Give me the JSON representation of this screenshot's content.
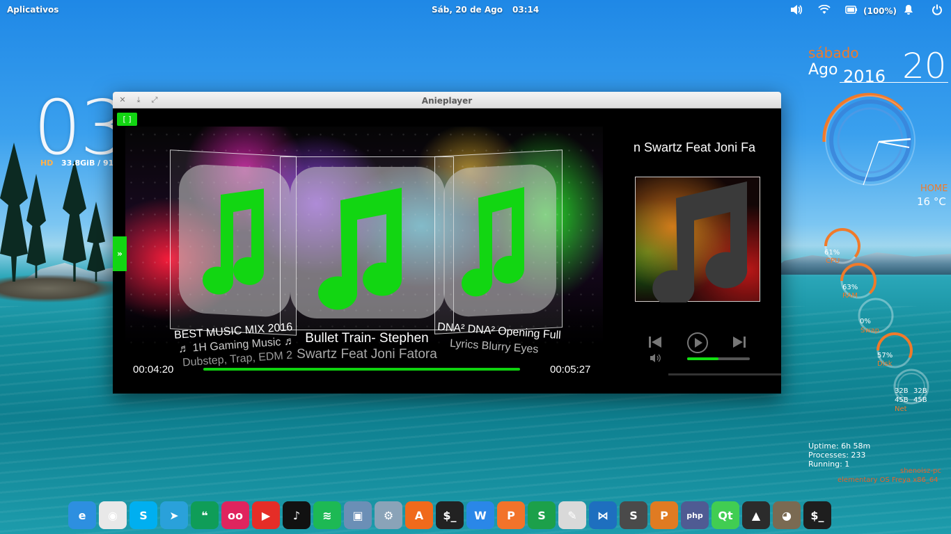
{
  "panel": {
    "apps_label": "Aplicativos",
    "date": "Sáb, 20 de Ago",
    "time": "03:14",
    "battery": "(100%)"
  },
  "conky_left": {
    "big_time": "03",
    "hd_label": "HD",
    "disk_info": "33.8GiB / 91."
  },
  "conky_right": {
    "weekday": "sábado",
    "month": "Ago",
    "year": "2016",
    "day": "20",
    "location": "HOME",
    "temperature": "16 °C",
    "gauges": [
      {
        "value": "61%",
        "label": "CPU",
        "level": 0.61
      },
      {
        "value": "63%",
        "label": "RAM",
        "level": 0.63
      },
      {
        "value": "0%",
        "label": "Swap",
        "level": 0.0
      },
      {
        "value": "57%",
        "label": "Disk",
        "level": 0.57
      }
    ],
    "net": {
      "down_a": "32B",
      "down_b": "32B",
      "up_a": "45B",
      "up_b": "45B",
      "label": "Net"
    },
    "uptime": "Uptime: 6h 58m",
    "processes": "Processes: 233",
    "running": "Running: 1",
    "hostname": "shenoisz-pc",
    "os": "elementary OS Freya  x86_64"
  },
  "player": {
    "window_title": "Anieplayer",
    "fullscreen_label": "[ ]",
    "expand_label": "»",
    "now_playing_title": "n Swartz Feat Joni Fa",
    "covers": [
      {
        "line1": "BEST MUSIC MIX 2016",
        "line2": "♬ 1H Gaming Music ♬",
        "line3": "Dubstep, Trap, EDM 2"
      },
      {
        "line1": "Bullet Train- Stephen",
        "line2": "Swartz Feat Joni Fatora"
      },
      {
        "line1": "DNA² DNA² Opening Full",
        "line2": "Lyrics Blurry Eyes"
      }
    ],
    "elapsed": "00:04:20",
    "total": "00:05:27",
    "progress": 1.0,
    "volume": 0.5
  },
  "dock": [
    {
      "name": "elementary",
      "color": "#2d8fe0",
      "glyph": "e"
    },
    {
      "name": "chrome",
      "color": "#e8e8e8",
      "glyph": "◉"
    },
    {
      "name": "skype",
      "color": "#00aff0",
      "glyph": "S"
    },
    {
      "name": "telegram",
      "color": "#2aa1da",
      "glyph": "➤"
    },
    {
      "name": "hangouts",
      "color": "#0f9d58",
      "glyph": "❝"
    },
    {
      "name": "flickr",
      "color": "#e0245e",
      "glyph": "oo"
    },
    {
      "name": "youtube",
      "color": "#e52d27",
      "glyph": "▶"
    },
    {
      "name": "anieplayer",
      "color": "#111111",
      "glyph": "♪"
    },
    {
      "name": "spotify",
      "color": "#1db954",
      "glyph": "≋"
    },
    {
      "name": "shotwell",
      "color": "#6b8fb6",
      "glyph": "▣"
    },
    {
      "name": "switchboard",
      "color": "#8aa3b8",
      "glyph": "⚙"
    },
    {
      "name": "appcenter",
      "color": "#f06a1b",
      "glyph": "A"
    },
    {
      "name": "terminal",
      "color": "#222222",
      "glyph": "$_"
    },
    {
      "name": "wps-writer",
      "color": "#2a87e8",
      "glyph": "W"
    },
    {
      "name": "wps-presentation",
      "color": "#f2732a",
      "glyph": "P"
    },
    {
      "name": "wps-spreadsheets",
      "color": "#1ca04a",
      "glyph": "S"
    },
    {
      "name": "text-editor",
      "color": "#d9d9d9",
      "glyph": "✎"
    },
    {
      "name": "vscode",
      "color": "#1e6fbf",
      "glyph": "⋈"
    },
    {
      "name": "sublime-text",
      "color": "#4a4a4a",
      "glyph": "S"
    },
    {
      "name": "pycharm",
      "color": "#e07b22",
      "glyph": "P"
    },
    {
      "name": "php",
      "color": "#4f5b93",
      "glyph": "php"
    },
    {
      "name": "qt-creator",
      "color": "#41cd52",
      "glyph": "Qt"
    },
    {
      "name": "inkscape",
      "color": "#2b2b2b",
      "glyph": "▲"
    },
    {
      "name": "gimp",
      "color": "#7a6a52",
      "glyph": "◕"
    },
    {
      "name": "terminal-2",
      "color": "#1e1e1e",
      "glyph": "$_"
    }
  ]
}
